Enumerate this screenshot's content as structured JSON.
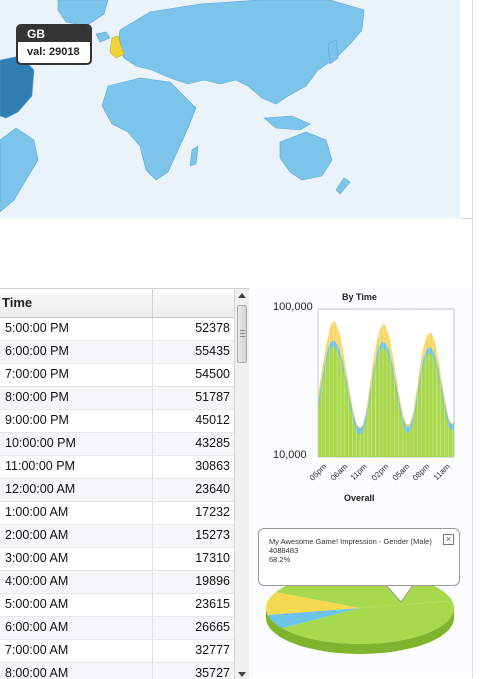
{
  "map": {
    "tooltip": {
      "region": "GB",
      "value_text": "val: 29018"
    },
    "colors": {
      "ocean": "#eaf3f9",
      "land": "#7dc4ea",
      "land_border": "#5aa7d4",
      "dark": "#2f7fb5",
      "highlight": "#f2d43a"
    }
  },
  "table": {
    "header": {
      "time": "Time",
      "value": ""
    },
    "rows": [
      {
        "time": "5:00:00 PM",
        "value": "52378"
      },
      {
        "time": "6:00:00 PM",
        "value": "55435"
      },
      {
        "time": "7:00:00 PM",
        "value": "54500"
      },
      {
        "time": "8:00:00 PM",
        "value": "51787"
      },
      {
        "time": "9:00:00 PM",
        "value": "45012"
      },
      {
        "time": "10:00:00 PM",
        "value": "43285"
      },
      {
        "time": "11:00:00 PM",
        "value": "30863"
      },
      {
        "time": "12:00:00 AM",
        "value": "23640"
      },
      {
        "time": "1:00:00 AM",
        "value": "17232"
      },
      {
        "time": "2:00:00 AM",
        "value": "15273"
      },
      {
        "time": "3:00:00 AM",
        "value": "17310"
      },
      {
        "time": "4:00:00 AM",
        "value": "19896"
      },
      {
        "time": "5:00:00 AM",
        "value": "23615"
      },
      {
        "time": "6:00:00 AM",
        "value": "26665"
      },
      {
        "time": "7:00:00 AM",
        "value": "32777"
      },
      {
        "time": "8:00:00 AM",
        "value": "35727"
      }
    ]
  },
  "chart_data": [
    {
      "type": "area",
      "title": "By Time",
      "xlabel": "Overall",
      "ylabel": "",
      "y_scale": "log",
      "ylim": [
        10000,
        100000
      ],
      "yticks": [
        "100,000",
        "10,000"
      ],
      "xticks": [
        "05pm",
        "06am",
        "11pm",
        "02pm",
        "05am",
        "08pm",
        "11am"
      ],
      "series": [
        {
          "color": "#a9d84a",
          "values": [
            34,
            40,
            48,
            55,
            62,
            68,
            72,
            74,
            75,
            74,
            72,
            69,
            65,
            60,
            54,
            47,
            40,
            33,
            27,
            22,
            18,
            16,
            15,
            16,
            19,
            24,
            30,
            38,
            46,
            54,
            61,
            67,
            71,
            73,
            74,
            73,
            71,
            68,
            63,
            57,
            50,
            43,
            36,
            30,
            24,
            20,
            17,
            16,
            17,
            20,
            25,
            32,
            40,
            48,
            56,
            62,
            66,
            69,
            70,
            70,
            68,
            65,
            60,
            54,
            47,
            40,
            33,
            27,
            22,
            19,
            18,
            19
          ]
        },
        {
          "color": "#6fc3ea",
          "values": [
            37,
            44,
            52,
            59,
            66,
            72,
            76,
            78,
            79,
            78,
            76,
            73,
            69,
            64,
            58,
            51,
            44,
            37,
            31,
            26,
            22,
            20,
            19,
            20,
            23,
            28,
            34,
            42,
            50,
            58,
            65,
            71,
            75,
            77,
            78,
            77,
            75,
            72,
            67,
            61,
            54,
            47,
            40,
            34,
            28,
            24,
            21,
            20,
            21,
            24,
            29,
            36,
            44,
            52,
            60,
            66,
            70,
            73,
            74,
            74,
            72,
            69,
            64,
            58,
            51,
            44,
            37,
            31,
            26,
            23,
            22,
            23
          ]
        },
        {
          "color": "#f7d764",
          "values": [
            42,
            50,
            58,
            66,
            74,
            80,
            86,
            90,
            92,
            91,
            88,
            84,
            79,
            72,
            65,
            57,
            49,
            41,
            34,
            28,
            24,
            21,
            20,
            21,
            25,
            31,
            39,
            48,
            57,
            66,
            74,
            80,
            85,
            88,
            90,
            89,
            86,
            82,
            76,
            69,
            61,
            53,
            45,
            37,
            31,
            26,
            23,
            22,
            23,
            27,
            33,
            41,
            50,
            59,
            67,
            74,
            79,
            82,
            84,
            84,
            82,
            78,
            72,
            65,
            57,
            49,
            41,
            34,
            28,
            24,
            23,
            24
          ]
        }
      ]
    },
    {
      "type": "pie",
      "slices": [
        {
          "label": "My Awesome Game! Impression - Gender (Male)",
          "value": 4088483,
          "percent_text": "68.2%",
          "color": "#a6d94b"
        },
        {
          "label": "",
          "value": 0,
          "color": "#6cc4ec"
        },
        {
          "label": "",
          "value": 0,
          "color": "#f6d94e"
        }
      ],
      "tooltip": {
        "title": "My Awesome Game! Impression - Gender (Male)",
        "count": "4088483",
        "percent": "68.2%"
      }
    }
  ]
}
